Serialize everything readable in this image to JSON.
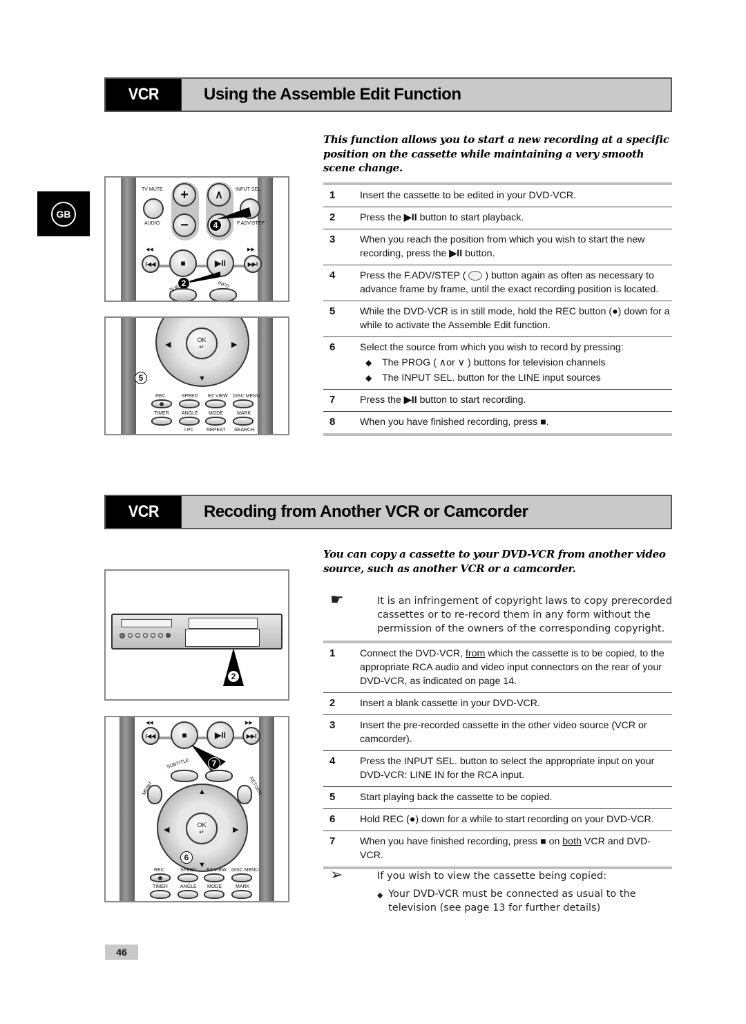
{
  "side_tab": {
    "label": "GB"
  },
  "section1": {
    "tag": "VCR",
    "title": "Using the Assemble Edit Function",
    "intro": "This function allows you to start a new recording at a specific position on the cassette while maintaining a very smooth scene change.",
    "steps": [
      {
        "num": "1",
        "text": "Insert the cassette to be edited in your DVD-VCR."
      },
      {
        "num": "2",
        "pre": "Press the ",
        "symbol": "▶II",
        "post": " button to start playback."
      },
      {
        "num": "3",
        "pre": "When you reach the position from which you wish to start the new recording, press the ",
        "symbol": "▶II",
        "post": " button."
      },
      {
        "num": "4",
        "pre": "Press the F.ADV/STEP ( ",
        "icon_label_top": "INPUT SEL.",
        "icon_label_bottom": "F.ADV/STEP",
        "post": " ) button again as often as necessary to advance frame by frame, until the exact recording position is located."
      },
      {
        "num": "5",
        "pre": "While the DVD-VCR is in still mode, hold the REC button (",
        "symbol": "●",
        "post": ") down for a while to activate the Assemble Edit function."
      },
      {
        "num": "6",
        "text": "Select the source from which you wish to record by pressing:",
        "bullets": [
          "The  PROG ( ∧or ∨ ) buttons for television channels",
          "The INPUT SEL. button for the LINE input sources"
        ]
      },
      {
        "num": "7",
        "pre": "Press the ",
        "symbol": "▶II",
        "post": " button to start recording."
      },
      {
        "num": "8",
        "pre": "When you have finished recording, press ",
        "symbol": "■",
        "post": "."
      }
    ]
  },
  "section2": {
    "tag": "VCR",
    "title": "Recoding from Another VCR or Camcorder",
    "intro": "You can copy a cassette to your DVD-VCR from another video source, such as another VCR or a camcorder.",
    "notice": {
      "icon": "pointing-hand",
      "text": "It is an infringement of copyright laws to copy prerecorded cassettes or to re-record them in any form without the permission of the owners of the corresponding copyright."
    },
    "steps": [
      {
        "num": "1",
        "pre": "Connect the DVD-VCR, ",
        "underline": "from",
        "post": " which the cassette is to be copied, to the appropriate RCA audio and video input connectors on the rear of your DVD-VCR, as indicated on page 14."
      },
      {
        "num": "2",
        "text": "Insert a blank cassette in your DVD-VCR."
      },
      {
        "num": "3",
        "text": "Insert the pre-recorded cassette in the other video source (VCR or camcorder)."
      },
      {
        "num": "4",
        "text": "Press the INPUT SEL. button to select the appropriate input on your DVD-VCR: LINE IN for the RCA input."
      },
      {
        "num": "5",
        "text": "Start playing back the cassette to be copied."
      },
      {
        "num": "6",
        "pre": "Hold REC (",
        "symbol": "●",
        "post": ") down for a while to start recording on your DVD-VCR."
      },
      {
        "num": "7",
        "pre": "When you have finished recording, press ",
        "symbol": "■",
        "mid": "  on ",
        "underline": "both",
        "post": " VCR and DVD-VCR."
      }
    ],
    "tip": {
      "icon": "arrow-tip",
      "text": "If you wish to view the cassette being copied:",
      "bullets": [
        "Your DVD-VCR must be connected as usual to the television (see page 13 for further details)"
      ]
    }
  },
  "figure1": {
    "labels": {
      "tv_mute": "TV MUTE",
      "audio": "AUDIO",
      "input_sel": "INPUT SEL.",
      "fadv_step": "F.ADV/STEP",
      "plus": "+",
      "minus": "−",
      "up": "∧",
      "subtitle": "SUB",
      "info": "INFO",
      "stop": "■",
      "play": "▶II",
      "prev": "I◀◀",
      "next": "▶▶I",
      "rew": "◀◀",
      "ff": "▶▶"
    },
    "callouts": [
      "4",
      "2"
    ]
  },
  "figure2": {
    "labels": {
      "ok": "OK",
      "enter": "↵",
      "rec": "REC",
      "speed": "SPEED",
      "ez_view": "EZ VIEW",
      "disc_menu": "DISC MENU",
      "timer": "TIMER",
      "angle": "ANGLE",
      "mode": "MODE",
      "mark": "MARK",
      "ipc": "I PC",
      "repeat": "REPEAT",
      "search": "SEARCH"
    },
    "callouts": [
      "5"
    ]
  },
  "figure3": {
    "callouts": [
      "2"
    ]
  },
  "figure4": {
    "labels": {
      "subtitle": "SUBTITLE",
      "menu": "MENU",
      "return": "RETURN",
      "ok": "OK",
      "enter": "↵",
      "rec": "REC",
      "speed": "SPEED",
      "ez_view": "EZ VIEW",
      "disc_menu": "DISC MENU",
      "timer": "TIMER",
      "angle": "ANGLE",
      "mode": "MODE",
      "mark": "MARK",
      "stop": "■",
      "play": "▶II",
      "prev": "I◀◀",
      "next": "▶▶I",
      "rew": "◀◀",
      "ff": "▶▶"
    },
    "callouts": [
      "7",
      "6"
    ]
  },
  "page_number": "46"
}
